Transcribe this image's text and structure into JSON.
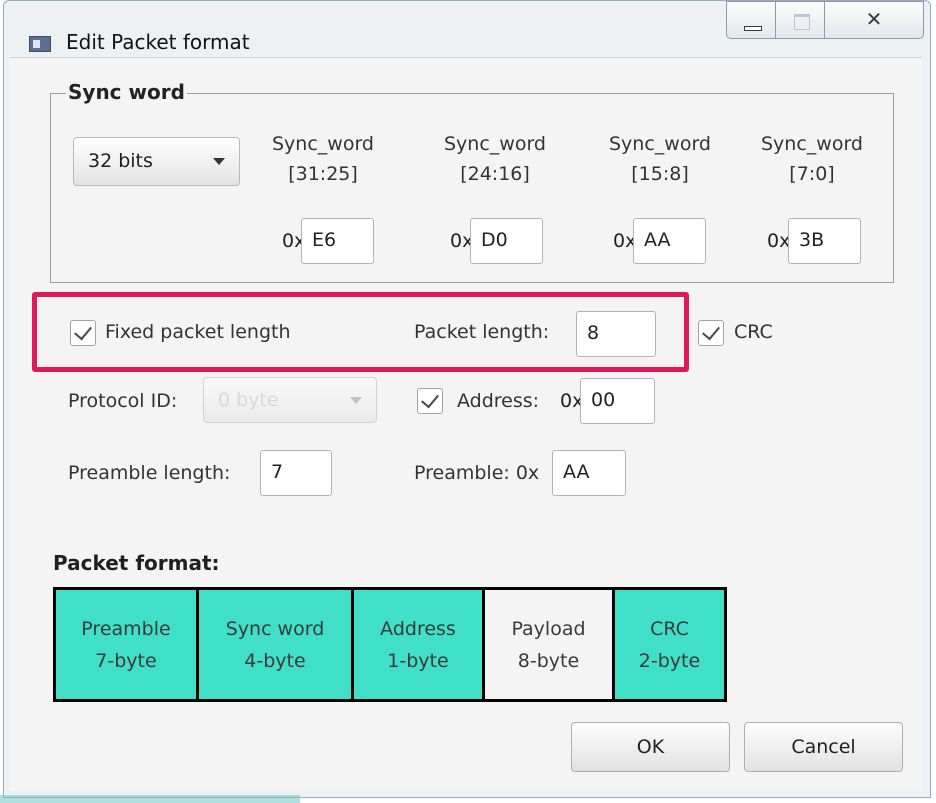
{
  "window": {
    "title": "Edit Packet format",
    "close_glyph": "✕"
  },
  "sync_word": {
    "legend": "Sync word",
    "bits_select": "32 bits",
    "columns": [
      {
        "label_1": "Sync_word",
        "label_2": "[31:25]",
        "prefix": "0x",
        "value": "E6"
      },
      {
        "label_1": "Sync_word",
        "label_2": "[24:16]",
        "prefix": "0x",
        "value": "D0"
      },
      {
        "label_1": "Sync_word",
        "label_2": "[15:8]",
        "prefix": "0x",
        "value": "AA"
      },
      {
        "label_1": "Sync_word",
        "label_2": "[7:0]",
        "prefix": "0x",
        "value": "3B"
      }
    ]
  },
  "options": {
    "fixed_length_label": "Fixed packet length",
    "fixed_length_checked": true,
    "packet_length_label": "Packet length:",
    "packet_length_value": "8",
    "crc_label": "CRC",
    "crc_checked": true,
    "protocol_id_label": "Protocol ID:",
    "protocol_id_value": "0 byte",
    "address_label": "Address:",
    "address_prefix": "0x",
    "address_value": "00",
    "address_checked": true,
    "preamble_length_label": "Preamble length:",
    "preamble_length_value": "7",
    "preamble_label": "Preamble: 0x",
    "preamble_value": "AA"
  },
  "packet_format": {
    "title": "Packet format:",
    "segments": [
      {
        "name": "Preamble",
        "size": "7-byte",
        "color": "#40e0c8"
      },
      {
        "name": "Sync word",
        "size": "4-byte",
        "color": "#40e0c8"
      },
      {
        "name": "Address",
        "size": "1-byte",
        "color": "#40e0c8"
      },
      {
        "name": "Payload",
        "size": "8-byte",
        "color": "#f4f4f4"
      },
      {
        "name": "CRC",
        "size": "2-byte",
        "color": "#40e0c8"
      }
    ]
  },
  "buttons": {
    "ok": "OK",
    "cancel": "Cancel"
  },
  "colors": {
    "highlight": "#e0195b",
    "segment_fill": "#40e0c8"
  }
}
